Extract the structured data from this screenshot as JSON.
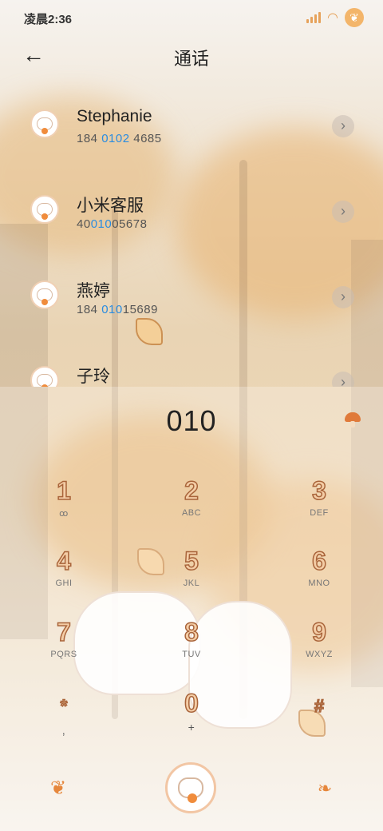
{
  "status_bar": {
    "time": "凌晨2:36"
  },
  "header": {
    "title": "通话"
  },
  "contacts": [
    {
      "name": "Stephanie",
      "number_pre": "184 ",
      "number_match": "0102",
      "number_post": " 4685"
    },
    {
      "name": "小米客服",
      "number_pre": "40",
      "number_match": "010",
      "number_post": "05678"
    },
    {
      "name": "燕婷",
      "number_pre": "184 ",
      "number_match": "010",
      "number_post": "15689"
    },
    {
      "name": "子玲",
      "number_pre": "",
      "number_match": "",
      "number_post": ""
    }
  ],
  "dialer": {
    "input": "010",
    "keys": [
      {
        "digit": "1",
        "letters": "ꝏ"
      },
      {
        "digit": "2",
        "letters": "ABC"
      },
      {
        "digit": "3",
        "letters": "DEF"
      },
      {
        "digit": "4",
        "letters": "GHI"
      },
      {
        "digit": "5",
        "letters": "JKL"
      },
      {
        "digit": "6",
        "letters": "MNO"
      },
      {
        "digit": "7",
        "letters": "PQRS"
      },
      {
        "digit": "8",
        "letters": "TUV"
      },
      {
        "digit": "9",
        "letters": "WXYZ"
      },
      {
        "digit": "*",
        "letters": ","
      },
      {
        "digit": "0",
        "letters": "+"
      },
      {
        "digit": "#",
        "letters": ""
      }
    ]
  },
  "icons": {
    "back": "arrow-left-icon",
    "detail": "chevron-right-icon",
    "settings": "mushroom-icon",
    "left_action": "maple-leaf-icon",
    "call": "call-button-icon",
    "right_action": "leaf-icon"
  },
  "colors": {
    "accent": "#e6873c",
    "match_highlight": "#2a8ce0",
    "digit_fill": "#f4cda6",
    "digit_stroke": "#a9643a"
  }
}
